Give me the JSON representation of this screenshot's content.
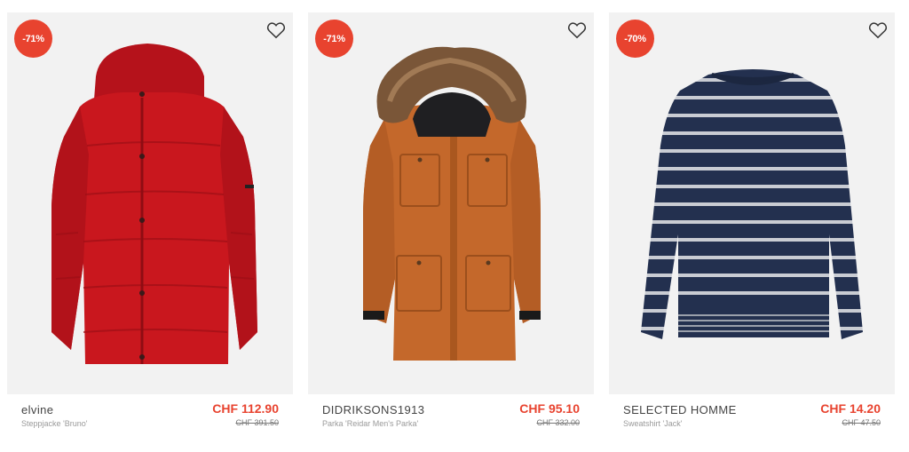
{
  "products": [
    {
      "discount": "-71%",
      "brand": "elvine",
      "model": "Steppjacke 'Bruno'",
      "price": "CHF 112.90",
      "old_price": "CHF 391.50",
      "image": "red-puffer-jacket",
      "accent": "#c9171e"
    },
    {
      "discount": "-71%",
      "brand": "DIDRIKSONS1913",
      "model": "Parka 'Reidar Men's Parka'",
      "price": "CHF 95.10",
      "old_price": "CHF 332.00",
      "image": "orange-parka-with-fur-hood",
      "accent": "#c4682b"
    },
    {
      "discount": "-70%",
      "brand": "SELECTED HOMME",
      "model": "Sweatshirt 'Jack'",
      "price": "CHF 14.20",
      "old_price": "CHF 47.50",
      "image": "navy-striped-sweatshirt",
      "accent": "#23304f"
    }
  ],
  "icons": {
    "wishlist": "heart-outline-icon"
  },
  "colors": {
    "sale": "#e8432f",
    "card_bg": "#f2f2f2"
  }
}
